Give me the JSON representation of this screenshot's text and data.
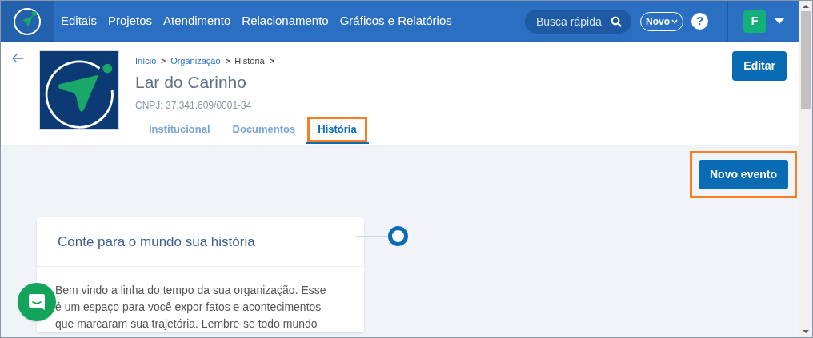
{
  "nav": {
    "items": [
      "Editais",
      "Projetos",
      "Atendimento",
      "Relacionamento",
      "Gráficos e Relatórios"
    ],
    "search": {
      "placeholder": "Busca rápida"
    },
    "new_button": "Novo",
    "help": "?",
    "avatar": "F"
  },
  "header": {
    "breadcrumb": [
      "Início",
      "Organização",
      "História"
    ],
    "separator": ">",
    "title": "Lar do Carinho",
    "cnpj": "CNPJ: 37.341.609/0001-34",
    "edit_button": "Editar",
    "tabs": [
      {
        "label": "Institucional",
        "selected": false,
        "highlighted": false
      },
      {
        "label": "Documentos",
        "selected": false,
        "highlighted": false
      },
      {
        "label": "História",
        "selected": true,
        "highlighted": true
      }
    ]
  },
  "content": {
    "new_event_button": {
      "label": "Novo evento",
      "highlighted": true
    },
    "card": {
      "title": "Conte para o mundo sua história",
      "body": "Bem vindo a linha do tempo da sua organização. Esse é um espaço para você expor fatos e acontecimentos que marcaram sua trajetória. Lembre-se todo mundo"
    }
  }
}
